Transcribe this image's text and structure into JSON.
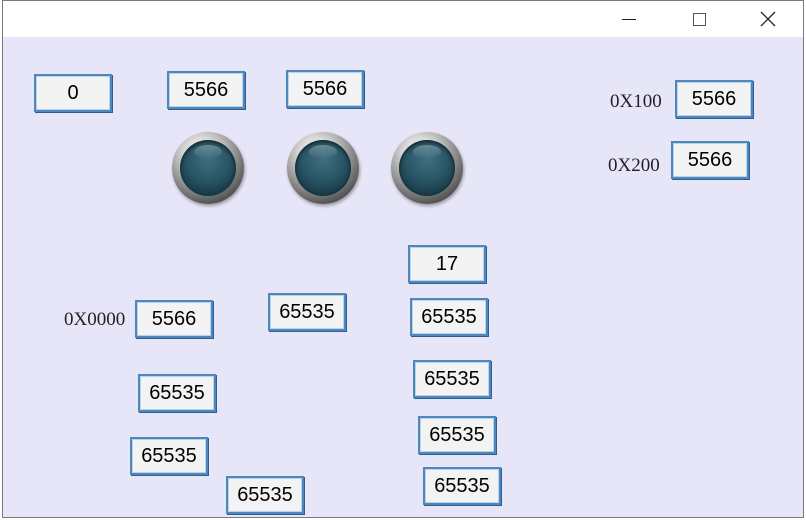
{
  "titlebar": {
    "minimize_icon": "minimize-icon",
    "maximize_icon": "maximize-icon",
    "close_icon": "close-icon"
  },
  "labels": {
    "addr_0x100": "0X100",
    "addr_0x200": "0X200",
    "addr_0x0000": "0X0000"
  },
  "values": {
    "v1": "0",
    "v2": "5566",
    "v3": "5566",
    "v4": "5566",
    "v5": "5566",
    "v6": "17",
    "v7": "5566",
    "v8": "65535",
    "v9": "65535",
    "v10": "65535",
    "v11": "65535",
    "v12": "65535",
    "v13": "65535",
    "v14": "65535",
    "v15": "65535"
  },
  "lamps": {
    "state_1": "off",
    "state_2": "off",
    "state_3": "off",
    "color": "#2a5666"
  }
}
